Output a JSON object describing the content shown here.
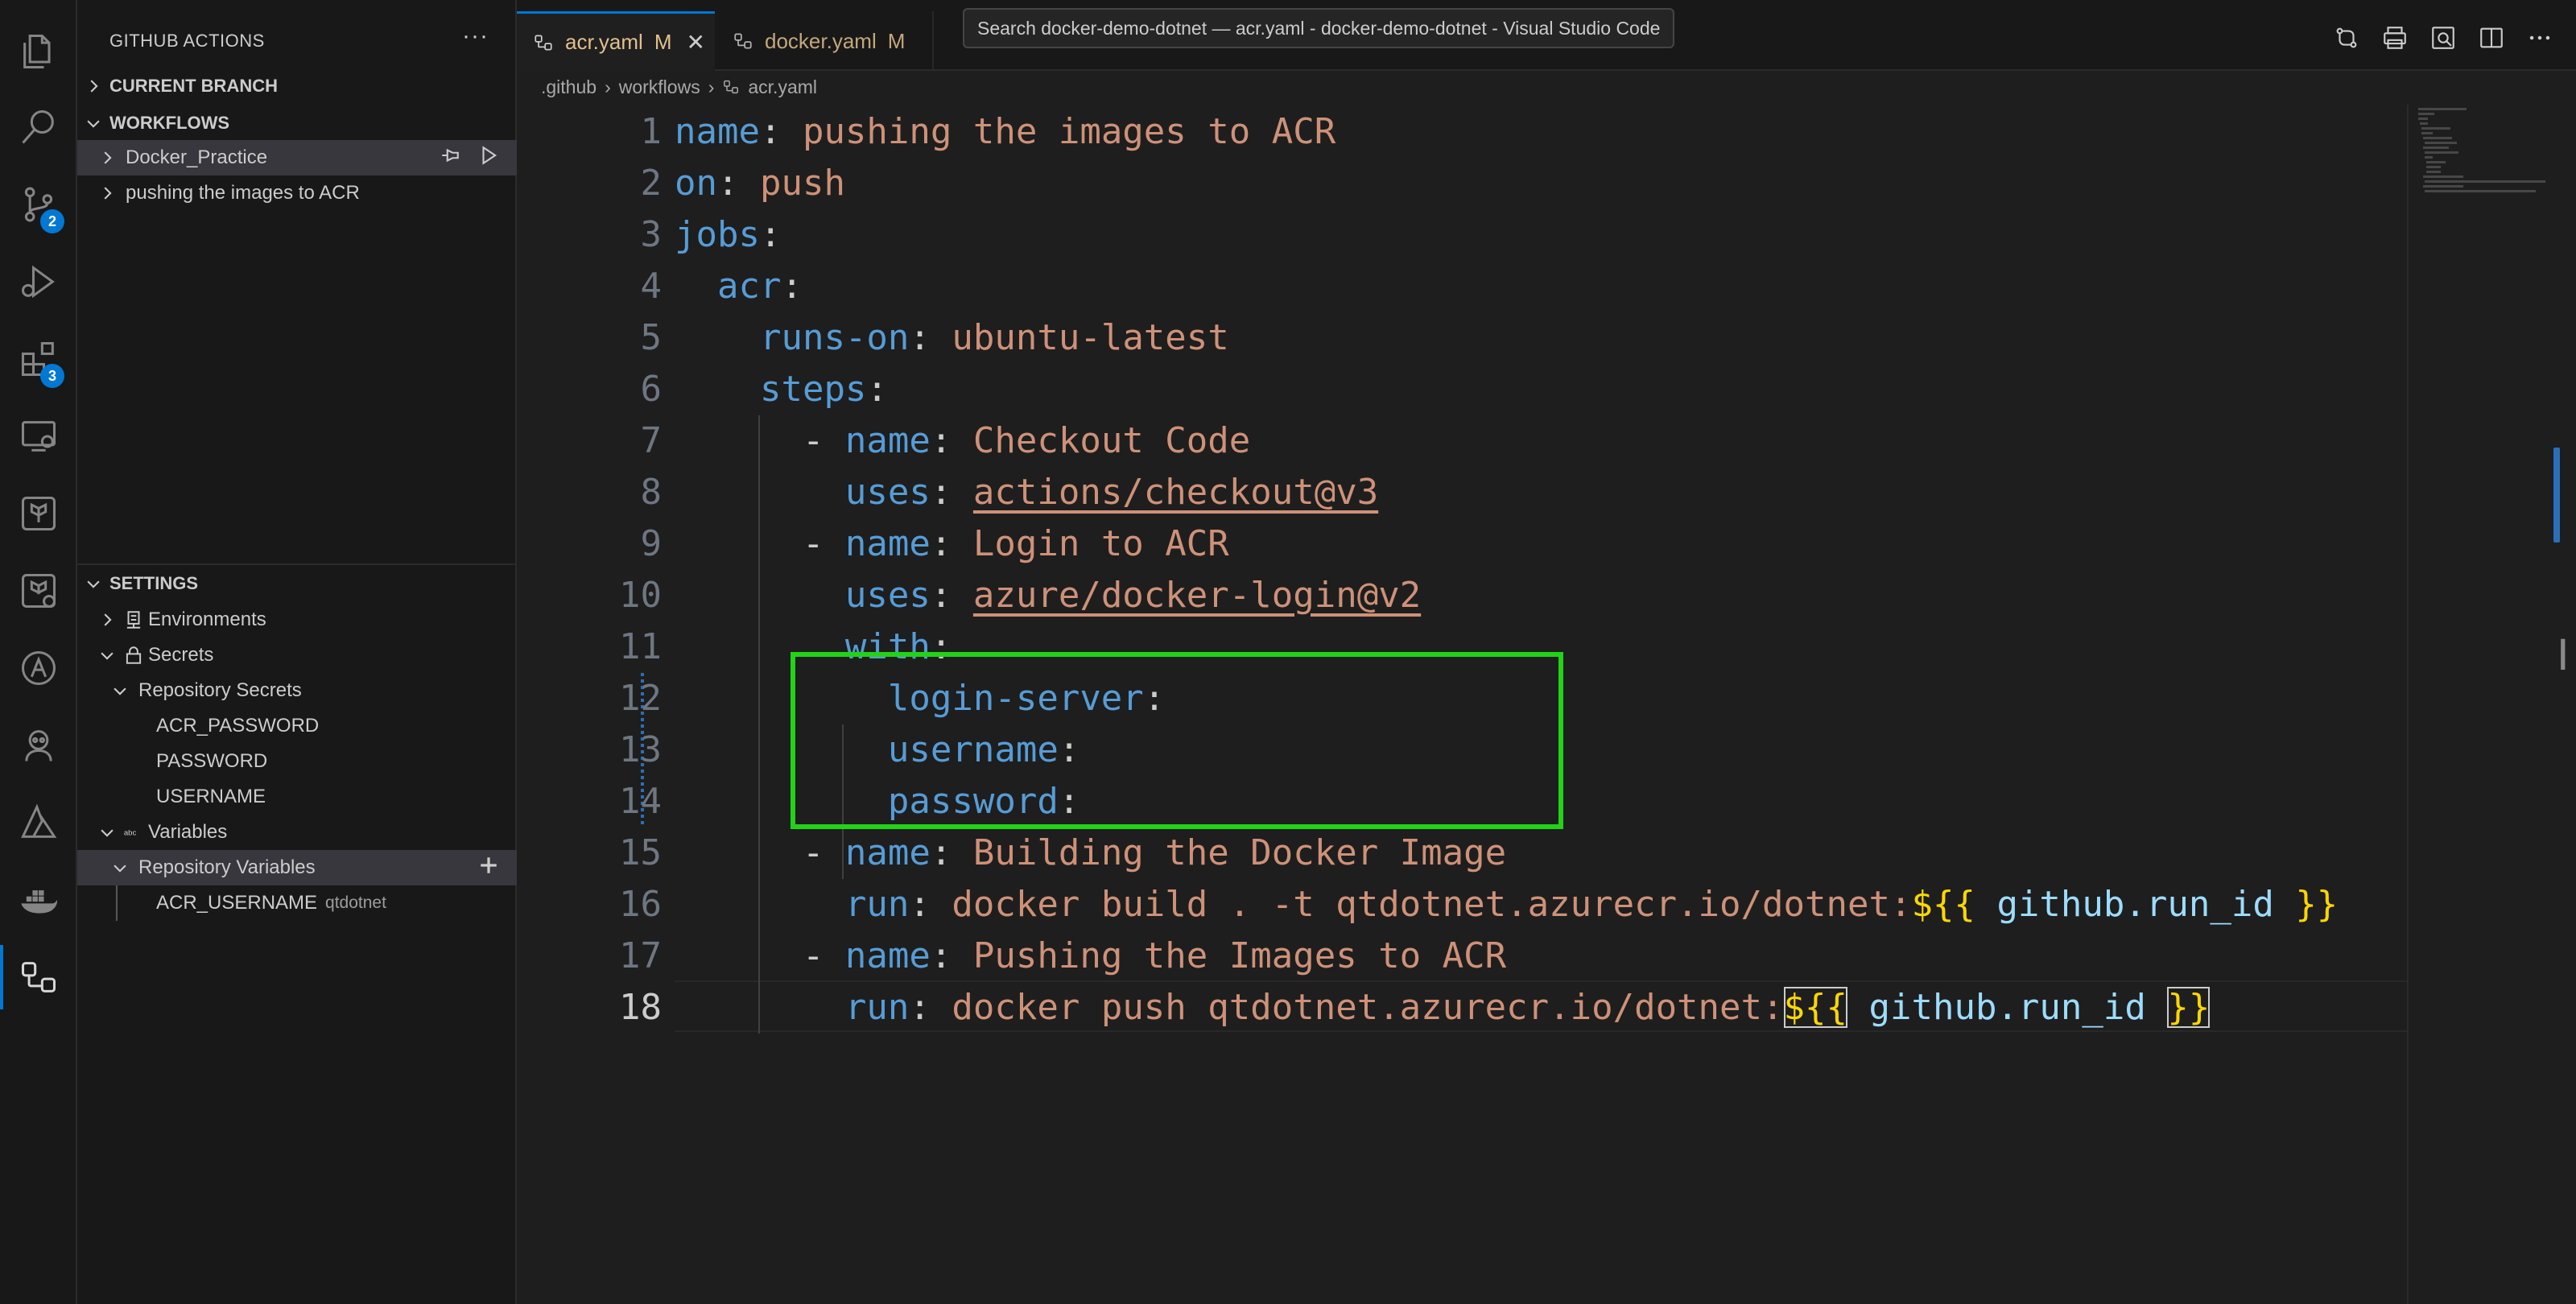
{
  "window": {
    "tooltip": "Search docker-demo-dotnet — acr.yaml - docker-demo-dotnet - Visual Studio Code"
  },
  "activity_bar": {
    "items": [
      {
        "name": "explorer-icon"
      },
      {
        "name": "search-icon"
      },
      {
        "name": "source-control-icon",
        "badge": "2"
      },
      {
        "name": "run-debug-icon"
      },
      {
        "name": "extensions-icon",
        "badge": "3"
      },
      {
        "name": "remote-explorer-icon"
      },
      {
        "name": "terraform-icon"
      },
      {
        "name": "terraform-cloud-icon"
      },
      {
        "name": "azure-a-icon"
      },
      {
        "name": "github-copilot-icon"
      },
      {
        "name": "azure-icon"
      },
      {
        "name": "docker-icon"
      },
      {
        "name": "github-actions-icon",
        "active": true
      }
    ]
  },
  "sidebar": {
    "title": "GITHUB ACTIONS",
    "more": "···",
    "sections": {
      "current_branch": "CURRENT BRANCH",
      "workflows": "WORKFLOWS",
      "settings": "SETTINGS"
    },
    "workflows": [
      "Docker_Practice",
      "pushing the images to ACR"
    ],
    "settings": {
      "environments": "Environments",
      "secrets": "Secrets",
      "repository_secrets": "Repository Secrets",
      "secret_items": [
        "ACR_PASSWORD",
        "PASSWORD",
        "USERNAME"
      ],
      "variables": "Variables",
      "repository_variables": "Repository Variables",
      "variable_items": [
        {
          "name": "ACR_USERNAME",
          "value": "qtdotnet"
        }
      ]
    }
  },
  "tabs": [
    {
      "label": "acr.yaml",
      "status": "M",
      "active": true
    },
    {
      "label": "docker.yaml",
      "status": "M",
      "active": false
    }
  ],
  "breadcrumb": [
    ".github",
    "workflows",
    "acr.yaml"
  ],
  "editor": {
    "current_line": 18,
    "line_numbers": [
      "1",
      "2",
      "3",
      "4",
      "5",
      "6",
      "7",
      "8",
      "9",
      "10",
      "11",
      "12",
      "13",
      "14",
      "15",
      "16",
      "17",
      "18"
    ],
    "code": {
      "l1_key": "name",
      "l1_val": "pushing the images to ACR",
      "l2_key": "on",
      "l2_val": "push",
      "l3_key": "jobs",
      "l4_key": "acr",
      "l5_key": "runs-on",
      "l5_val": "ubuntu-latest",
      "l6_key": "steps",
      "l7_key": "name",
      "l7_val": "Checkout Code",
      "l8_key": "uses",
      "l8_val": "actions/checkout@v3",
      "l9_key": "name",
      "l9_val": "Login to ACR",
      "l10_key": "uses",
      "l10_val": "azure/docker-login@v2",
      "l11_key": "with",
      "l12_key": "login-server",
      "l13_key": "username",
      "l14_key": "password",
      "l15_key": "name",
      "l15_val": "Building the Docker Image",
      "l16_key": "run",
      "l16_val": "docker build . -t qtdotnet.azurecr.io/dotnet:",
      "l17_key": "name",
      "l17_val": "Pushing the Images to ACR",
      "l18_key": "run",
      "l18_val": "docker push qtdotnet.azurecr.io/dotnet:",
      "expr_open": "${{",
      "expr_var": "github.run_id",
      "expr_close": "}}"
    }
  },
  "colors": {
    "accent": "#0078d4",
    "highlight_box": "#22d316",
    "modified_tab": "#e2c08d"
  }
}
